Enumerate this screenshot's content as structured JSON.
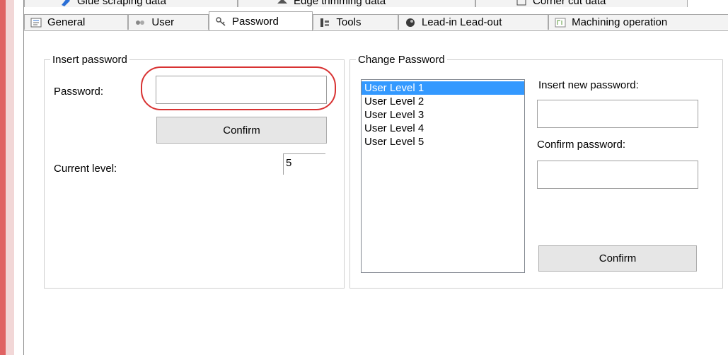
{
  "tabs_top": [
    {
      "label": "Glue scraping data",
      "icon": "glue-icon"
    },
    {
      "label": "Edge trimming data",
      "icon": "trim-icon"
    },
    {
      "label": "Corner cut data",
      "icon": "corner-icon"
    }
  ],
  "tabs": [
    {
      "label": "General",
      "icon": "general-icon"
    },
    {
      "label": "User",
      "icon": "user-icon"
    },
    {
      "label": "Password",
      "icon": "password-icon",
      "active": true
    },
    {
      "label": "Tools",
      "icon": "tools-icon"
    },
    {
      "label": "Lead-in Lead-out",
      "icon": "lead-icon"
    },
    {
      "label": "Machining operation",
      "icon": "machining-icon"
    }
  ],
  "insert_password": {
    "title": "Insert password",
    "password_label": "Password:",
    "password_value": "",
    "confirm_label": "Confirm",
    "current_level_label": "Current level:",
    "current_level_value": "5"
  },
  "change_password": {
    "title": "Change Password",
    "levels": [
      "User Level 1",
      "User Level 2",
      "User Level 3",
      "User Level 4",
      "User Level 5"
    ],
    "selected_index": 0,
    "new_password_label": "Insert new password:",
    "confirm_password_label": "Confirm password:",
    "confirm_label": "Confirm"
  },
  "colors": {
    "accent_selection": "#3399ff",
    "highlight_ring": "#d83232"
  }
}
